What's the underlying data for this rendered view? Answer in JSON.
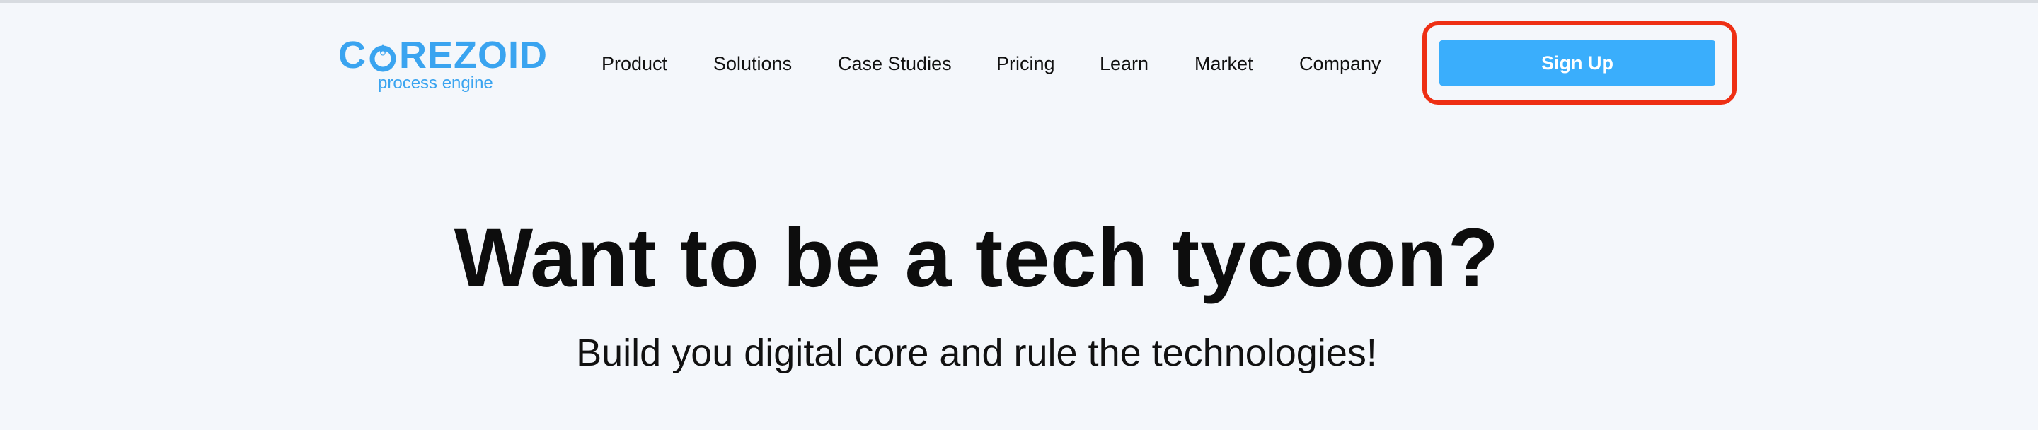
{
  "logo": {
    "brand_prefix": "C",
    "brand_suffix": "REZOID",
    "tagline": "process engine",
    "brand_color": "#3aa4f0"
  },
  "nav": {
    "items": [
      {
        "label": "Product"
      },
      {
        "label": "Solutions"
      },
      {
        "label": "Case Studies"
      },
      {
        "label": "Pricing"
      },
      {
        "label": "Learn"
      },
      {
        "label": "Market"
      },
      {
        "label": "Company"
      }
    ],
    "signup_label": "Sign Up",
    "signup_color": "#3aaefc",
    "highlight_color": "#ee2f14"
  },
  "hero": {
    "title": "Want to be a tech tycoon?",
    "subtitle": "Build you digital core and rule the technologies!"
  }
}
